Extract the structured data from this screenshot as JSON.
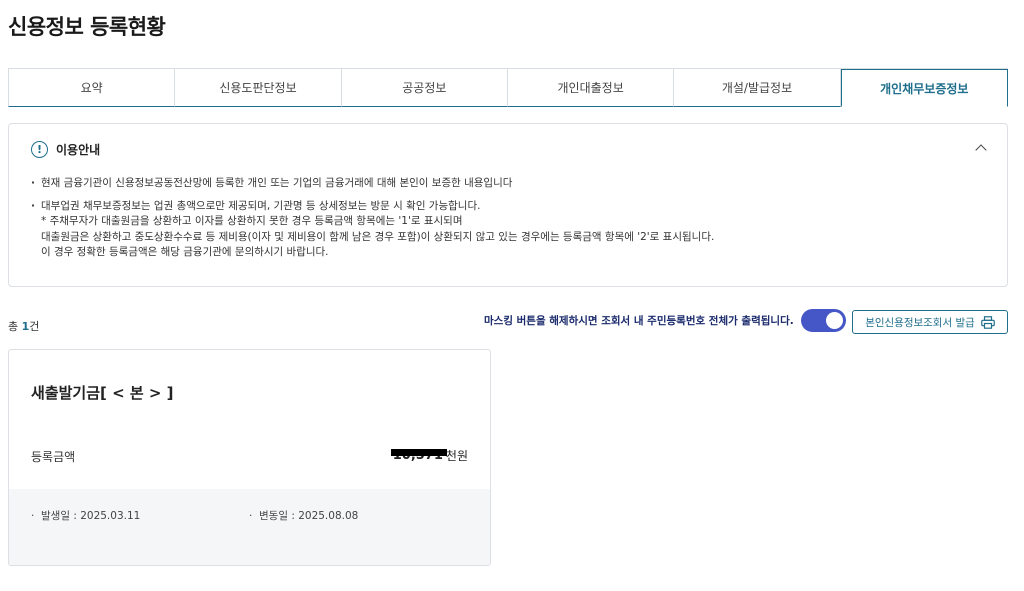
{
  "page": {
    "title": "신용정보 등록현황"
  },
  "tabs": [
    {
      "label": "요약"
    },
    {
      "label": "신용도판단정보"
    },
    {
      "label": "공공정보"
    },
    {
      "label": "개인대출정보"
    },
    {
      "label": "개설/발급정보"
    },
    {
      "label": "개인채무보증정보"
    }
  ],
  "notice": {
    "title": "이용안내",
    "para1": "현재 금융기관이 신용정보공동전산망에 등록한 개인 또는 기업의 금융거래에 대해 본인이 보증한 내용입니다",
    "para2_lines": [
      "대부업권 채무보증정보는 업권 총액으로만 제공되며, 기관명 등 상세정보는 방문 시 확인 가능합니다.",
      " * 주채무자가 대출원금을 상환하고 이자를 상환하지 못한 경우 등록금액 항목에는 '1'로 표시되며",
      "대출원금은 상환하고 중도상환수수료 등 제비용(이자 및 제비용이 함께 남은 경우 포함)이 상환되지 않고 있는 경우에는 등록금액 항목에 '2'로 표시됩니다.",
      " 이 경우 정확한 등록금액은 해당 금융기관에 문의하시기 바랍니다."
    ]
  },
  "summary": {
    "total_prefix": "총 ",
    "total_count": "1",
    "total_suffix": "건"
  },
  "masking": {
    "message": "마스킹 버튼을 해제하시면 조회서 내 주민등록번호 전체가 출력됩니다.",
    "enabled": true
  },
  "print_button": {
    "label": "본인신용정보조회서 발급"
  },
  "card": {
    "title": "새출발기금[ < 본 > ]",
    "amount_label": "등록금액",
    "amount_value": "10,571",
    "amount_unit": "천원",
    "occurred": "발생일 : 2025.03.11",
    "changed": "변동일 : 2025.08.08"
  },
  "colors": {
    "accent": "#1e6e8c",
    "toggle": "#4557c7",
    "mask_text": "#1a2a6c"
  }
}
